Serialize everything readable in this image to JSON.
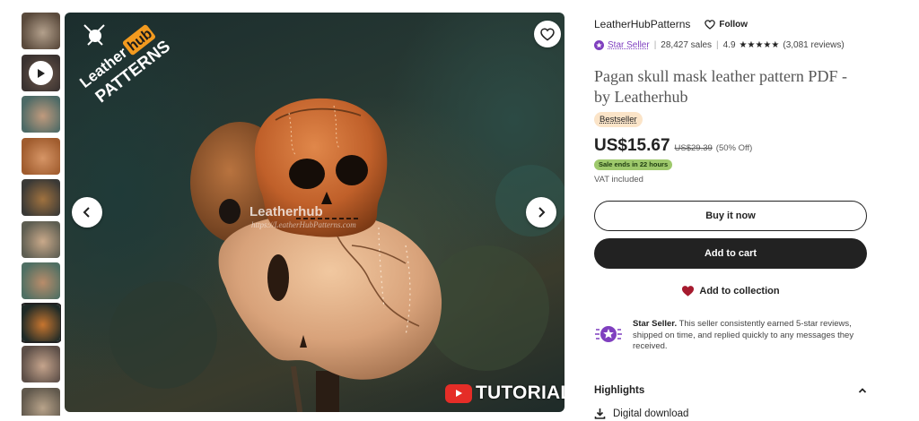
{
  "thumbnails": [
    {
      "name": "thumb-1",
      "colors": [
        "#5a4a3c",
        "#b3a08c"
      ]
    },
    {
      "name": "thumb-video",
      "colors": [
        "#3a3230",
        "#6f5a4d"
      ]
    },
    {
      "name": "thumb-3",
      "colors": [
        "#4d6a66",
        "#c09a7d"
      ]
    },
    {
      "name": "thumb-4",
      "colors": [
        "#a05c2e",
        "#d69566"
      ]
    },
    {
      "name": "thumb-5",
      "colors": [
        "#3a3936",
        "#a0723f"
      ]
    },
    {
      "name": "thumb-6",
      "colors": [
        "#5e5e52",
        "#c9a98a"
      ]
    },
    {
      "name": "thumb-7",
      "colors": [
        "#4f6f63",
        "#b98c6a"
      ]
    },
    {
      "name": "thumb-8",
      "colors": [
        "#1e2a27",
        "#c7752f"
      ]
    },
    {
      "name": "thumb-9",
      "colors": [
        "#5d4f48",
        "#c5a48c"
      ]
    },
    {
      "name": "thumb-10",
      "colors": [
        "#60584c",
        "#b8a38a"
      ]
    }
  ],
  "image": {
    "logo_top": "Leather",
    "logo_hub": "hub",
    "logo_bottom": "PATTERNS",
    "watermark": "Leatherhub",
    "watermark_url": "https://LeatherHubPatterns.com",
    "tutorial_label": "TUTORIAL"
  },
  "shop": {
    "name": "LeatherHubPatterns",
    "follow_label": "Follow",
    "star_seller_label": "Star Seller",
    "sales": "28,427 sales",
    "rating": "4.9",
    "stars": "★★★★★",
    "reviews": "(3,081 reviews)"
  },
  "listing": {
    "title": "Pagan skull mask leather pattern PDF - by Leatherhub",
    "badge": "Bestseller",
    "price": "US$15.67",
    "old_price": "US$29.39",
    "discount": "(50% Off)",
    "sale_ends": "Sale ends in 22 hours",
    "vat": "VAT included"
  },
  "actions": {
    "buy_now": "Buy it now",
    "add_to_cart": "Add to cart",
    "add_to_collection": "Add to collection"
  },
  "star_seller_info": {
    "bold": "Star Seller.",
    "text": " This seller consistently earned 5-star reviews, shipped on time, and replied quickly to any messages they received."
  },
  "highlights": {
    "heading": "Highlights",
    "item_1": "Digital download"
  },
  "colors": {
    "text": "#222222",
    "star_seller_purple": "#7f3fbf",
    "bestseller_bg": "#fbe4c8",
    "sale_green": "#9ec96c",
    "heart_red": "#a61a2e"
  }
}
